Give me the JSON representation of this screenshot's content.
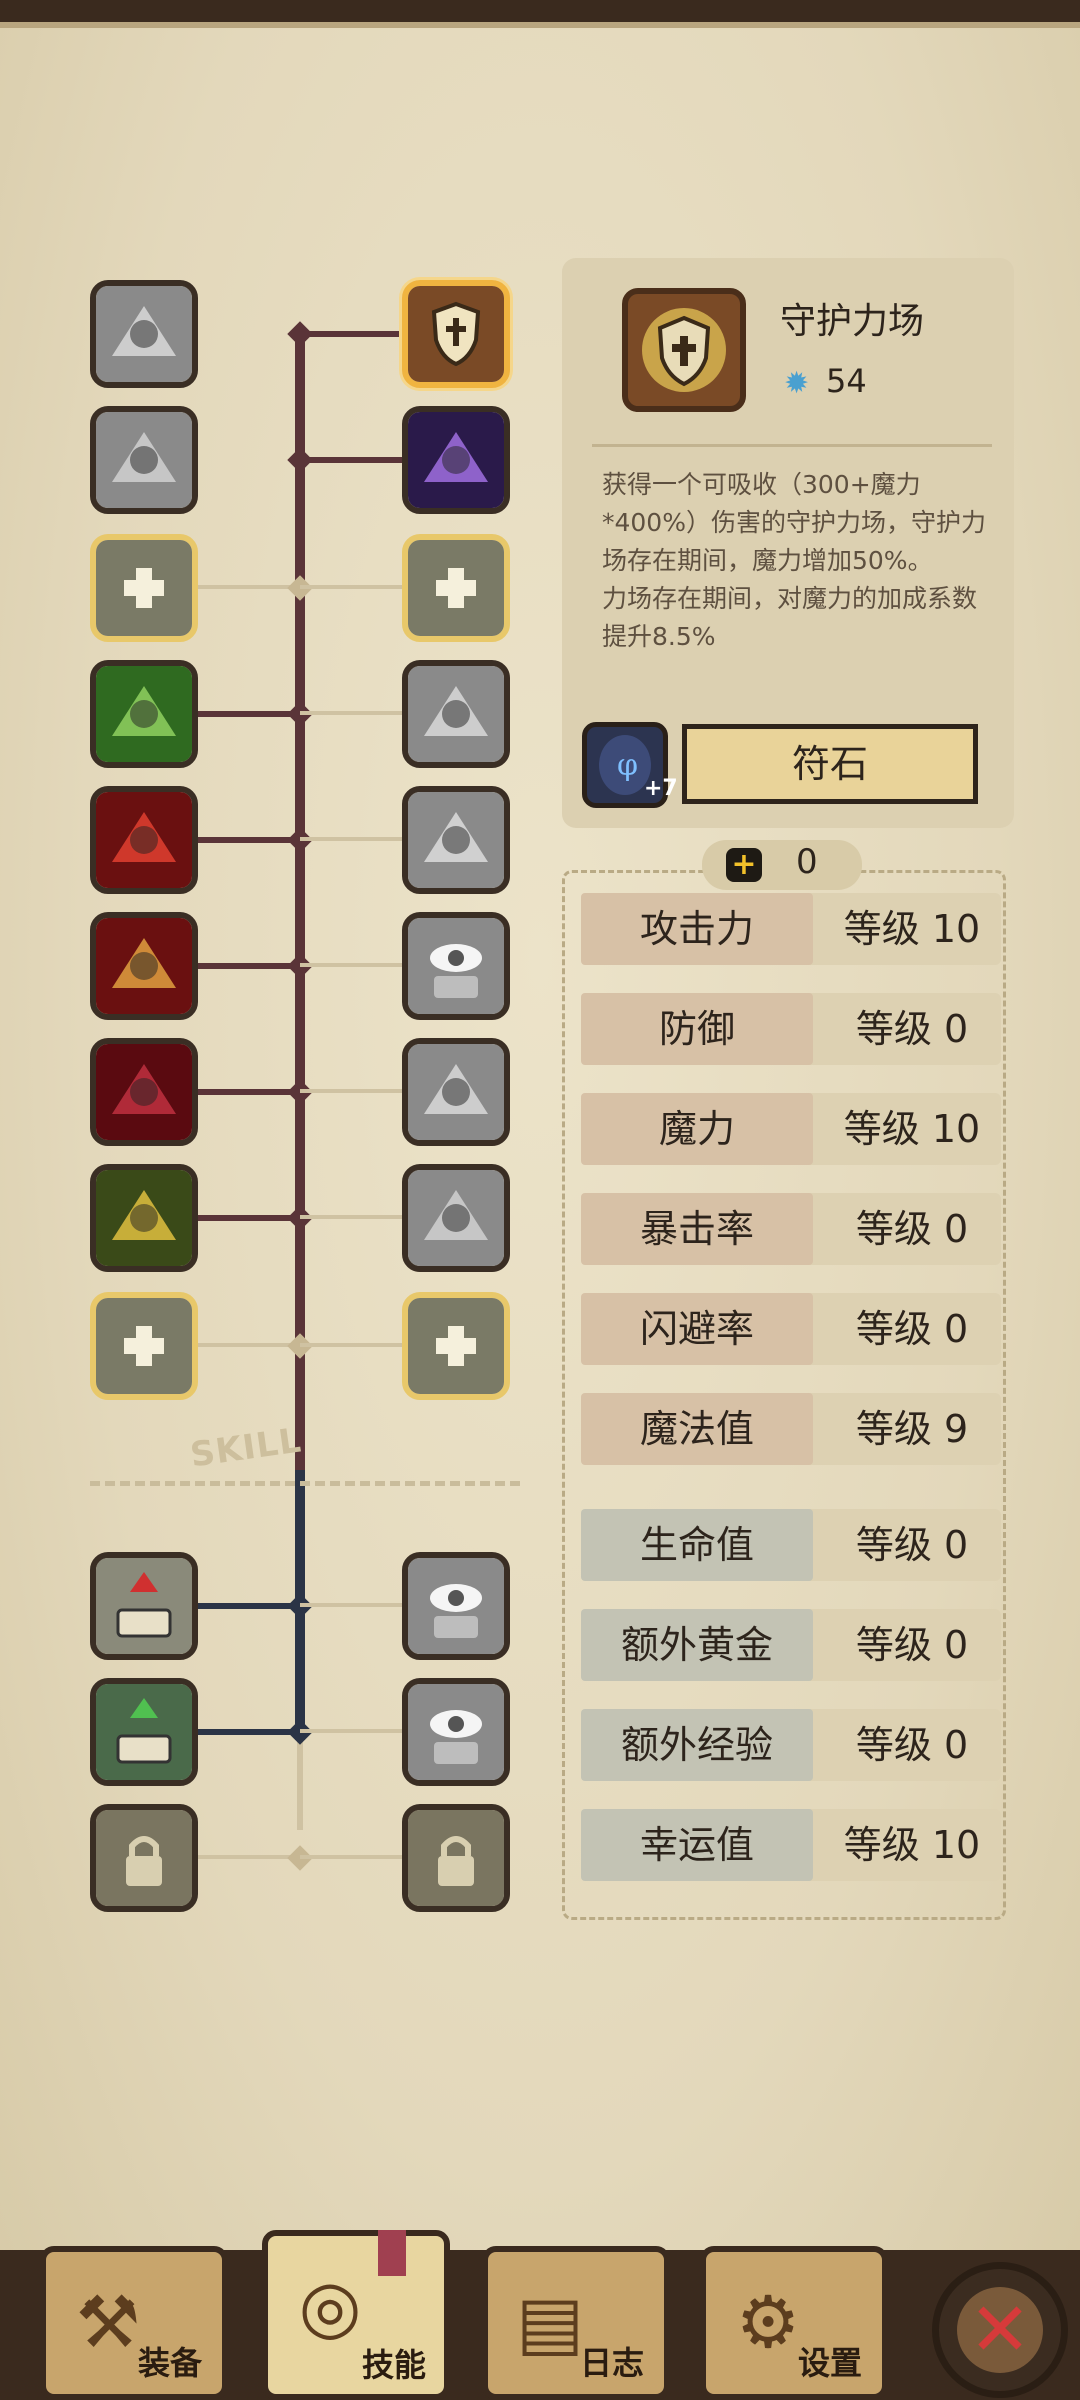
{
  "skill_tree": {
    "left_column": [
      {
        "icon": "lightning-slash-icon",
        "state": "locked"
      },
      {
        "icon": "dash-strike-icon",
        "state": "locked"
      },
      {
        "icon": "add-skill-icon",
        "state": "available"
      },
      {
        "icon": "muscle-arm-icon",
        "state": "learned"
      },
      {
        "icon": "spin-attack-icon",
        "state": "learned"
      },
      {
        "icon": "golden-dagger-icon",
        "state": "learned"
      },
      {
        "icon": "shadow-figure-icon",
        "state": "learned"
      },
      {
        "icon": "lightning-tree-icon",
        "state": "learned"
      },
      {
        "icon": "add-skill-icon",
        "state": "available"
      },
      {
        "icon": "treasure-down-icon",
        "state": "learned"
      },
      {
        "icon": "treasure-grab-icon",
        "state": "learned"
      },
      {
        "icon": "lock-icon",
        "state": "locked"
      }
    ],
    "right_column": [
      {
        "icon": "guardian-shield-icon",
        "state": "selected"
      },
      {
        "icon": "purple-blast-icon",
        "state": "learned"
      },
      {
        "icon": "add-skill-icon",
        "state": "available"
      },
      {
        "icon": "scroll-blast-icon",
        "state": "locked"
      },
      {
        "icon": "storm-figure-icon",
        "state": "locked"
      },
      {
        "icon": "eye-burst-icon",
        "state": "locked"
      },
      {
        "icon": "whirlwind-icon",
        "state": "locked"
      },
      {
        "icon": "orb-explosion-icon",
        "state": "locked"
      },
      {
        "icon": "add-skill-icon",
        "state": "available"
      },
      {
        "icon": "eye-chest-icon",
        "state": "locked"
      },
      {
        "icon": "eye-chest-icon",
        "state": "locked"
      },
      {
        "icon": "lock-icon",
        "state": "locked"
      }
    ],
    "divider_text": "SKILL"
  },
  "detail": {
    "name": "守护力场",
    "cost": "54",
    "desc_line1": "获得一个可吸收（300+魔力*400%）伤害的守护力场，守护力场存在期间，魔力增加50%。",
    "desc_line2": "力场存在期间，对魔力的加成系数提升8.5%",
    "rune_plus": "+7",
    "rune_button": "符石"
  },
  "points": "0",
  "stats": [
    {
      "label": "攻击力",
      "level": "等级 10",
      "group": "attr"
    },
    {
      "label": "防御",
      "level": "等级 0",
      "group": "attr"
    },
    {
      "label": "魔力",
      "level": "等级 10",
      "group": "attr"
    },
    {
      "label": "暴击率",
      "level": "等级 0",
      "group": "attr"
    },
    {
      "label": "闪避率",
      "level": "等级 0",
      "group": "attr"
    },
    {
      "label": "魔法值",
      "level": "等级 9",
      "group": "attr"
    },
    {
      "label": "生命值",
      "level": "等级 0",
      "group": "bonus"
    },
    {
      "label": "额外黄金",
      "level": "等级 0",
      "group": "bonus"
    },
    {
      "label": "额外经验",
      "level": "等级 0",
      "group": "bonus"
    },
    {
      "label": "幸运值",
      "level": "等级 10",
      "group": "bonus"
    }
  ],
  "nav": [
    {
      "label": "装备",
      "icon": "axe-icon"
    },
    {
      "label": "技能",
      "icon": "skill-target-icon",
      "active": true
    },
    {
      "label": "日志",
      "icon": "journal-icon"
    },
    {
      "label": "设置",
      "icon": "gear-icon"
    }
  ],
  "colors": {
    "parchment": "#e6dcc0",
    "selected_border": "#f0b440",
    "branch_red": "#5a3438",
    "branch_blue": "#2b3446",
    "close_red": "#d63a3a"
  }
}
